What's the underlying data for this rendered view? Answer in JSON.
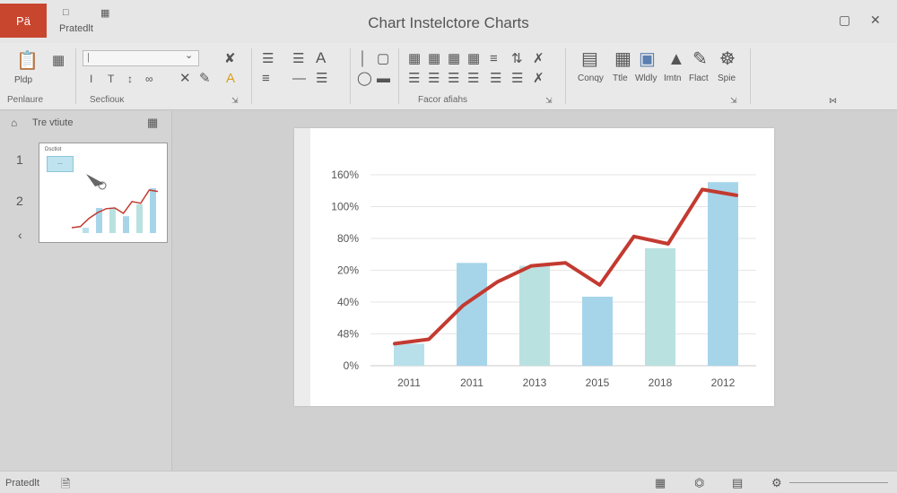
{
  "titlebar": {
    "app_badge": "Pä",
    "title": "Chart Instelctore Charts",
    "quick_access_sub": "Pratedlt",
    "qa_icons": [
      "file-icon",
      "save-icon"
    ],
    "window_buttons": [
      "▢",
      "✕"
    ]
  },
  "ribbon": {
    "font_box_value": "|",
    "paste_label": "Pldp",
    "insert_buttons": [
      "Conqy",
      "Ttle",
      "Wldly",
      "Imtn",
      "Flact",
      "Spie"
    ],
    "groups": [
      "Penlaure",
      "Secfiouĸ",
      "Facor afiahs"
    ]
  },
  "slides_panel": {
    "header_label": "Tre vtiute",
    "slide_numbers": [
      "1",
      "2"
    ],
    "collapse_glyph": "‹",
    "thumb_title": "Dsctlot",
    "thumb_box_text": "−−"
  },
  "chart_data": {
    "type": "bar",
    "categories": [
      "2011",
      "2011",
      "2013",
      "2015",
      "2018",
      "2012"
    ],
    "y_tick_labels": [
      "0%",
      "48%",
      "40%",
      "20%",
      "80%",
      "100%",
      "160%"
    ],
    "bar_values": [
      15,
      70,
      68,
      47,
      80,
      125
    ],
    "line_values": [
      15,
      18,
      41,
      57,
      68,
      70,
      55,
      88,
      83,
      120,
      116
    ],
    "bar_colors": [
      "#b7e0eb",
      "#a6d5ea",
      "#b9e1e0",
      "#a6d5ea",
      "#b9e1e0",
      "#a6d5ea"
    ],
    "line_color": "#c33a30",
    "grid": true
  },
  "statusbar": {
    "left_text": "Pratedlt"
  },
  "colors": {
    "accent": "#c8452e",
    "line": "#c33a30"
  }
}
